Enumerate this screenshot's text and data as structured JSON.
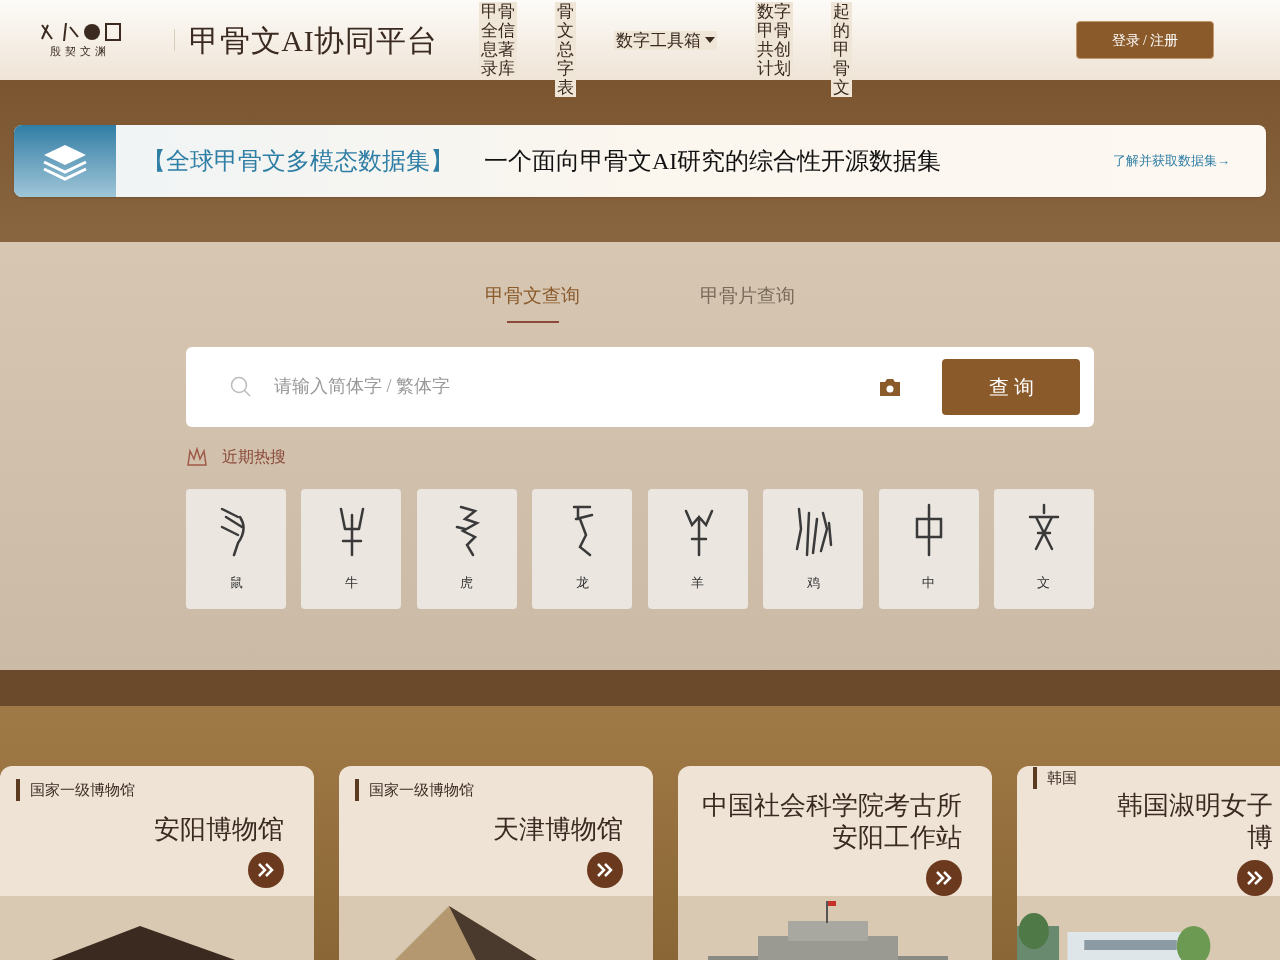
{
  "header": {
    "logo_caption": "殷契文渊",
    "site_title": "甲骨文AI协同平台",
    "nav": [
      {
        "lines": [
          "甲骨",
          "全信",
          "息著",
          "录库"
        ],
        "dropdown": false
      },
      {
        "lines": [
          "骨",
          "文",
          "总",
          "字",
          "表"
        ],
        "dropdown": false
      },
      {
        "lines": [
          "数字工具箱"
        ],
        "dropdown": true
      },
      {
        "lines": [
          "数字",
          "甲骨",
          "共创",
          "计划"
        ],
        "dropdown": false
      },
      {
        "lines": [
          "起",
          "的",
          "甲",
          "骨",
          "文"
        ],
        "dropdown": false
      }
    ],
    "login": "登录 / 注册"
  },
  "banner": {
    "tag": "【全球甲骨文多模态数据集】",
    "headline": "一个面向甲骨文AI研究的综合性开源数据集",
    "link": "了解并获取数据集→"
  },
  "search": {
    "tabs": [
      {
        "label": "甲骨文查询",
        "selected": true
      },
      {
        "label": "甲骨片查询",
        "selected": false
      }
    ],
    "placeholder": "请输入简体字 / 繁体字",
    "button": "查 询",
    "hot_label": "近期热搜",
    "hot": [
      {
        "char": "鼠"
      },
      {
        "char": "牛"
      },
      {
        "char": "虎"
      },
      {
        "char": "龙"
      },
      {
        "char": "羊"
      },
      {
        "char": "鸡"
      },
      {
        "char": "中"
      },
      {
        "char": "文"
      }
    ]
  },
  "museums": [
    {
      "tag": "国家一级博物馆",
      "title": [
        "安阳博物馆"
      ],
      "kind": "picture"
    },
    {
      "tag": "国家一级博物馆",
      "title": [
        "天津博物馆"
      ],
      "kind": "picture"
    },
    {
      "title": [
        "中国社会科学院考古所",
        "安阳工作站"
      ],
      "kind": "picture"
    },
    {
      "tag": "韩国",
      "title": [
        "韩国淑明女子",
        "博"
      ],
      "kind": "picture"
    }
  ]
}
